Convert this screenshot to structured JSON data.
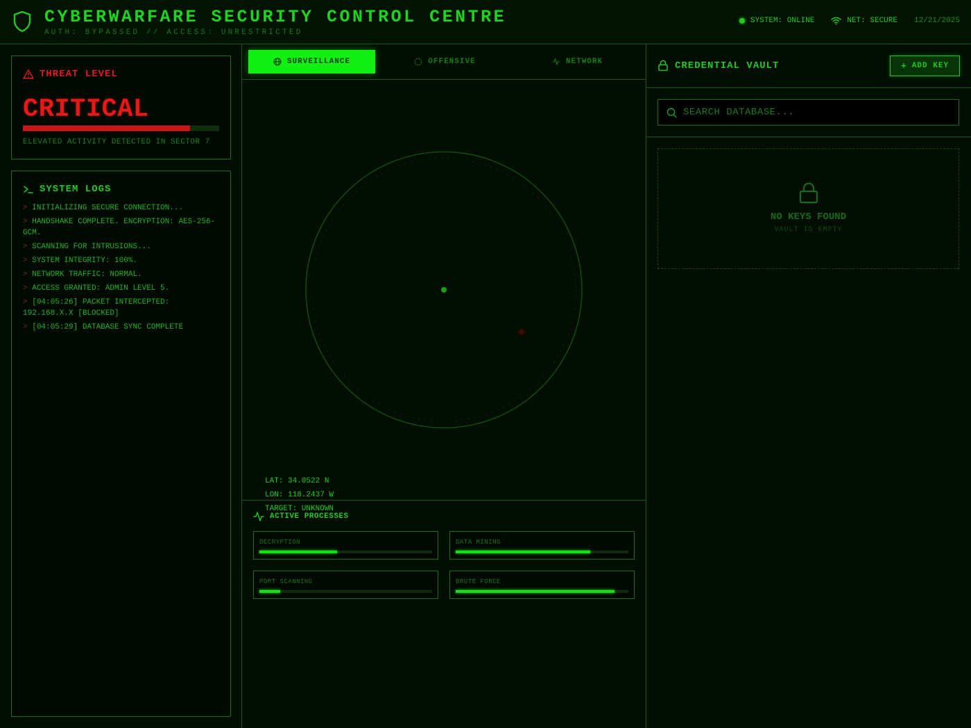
{
  "header": {
    "title": "CYBERWARFARE SECURITY CONTROL CENTRE",
    "subtitle": "AUTH: BYPASSED // ACCESS: UNRESTRICTED",
    "logo_icon": "shield-icon",
    "system_status": "SYSTEM: ONLINE",
    "net_status": "NET: SECURE",
    "date": "12/21/2025"
  },
  "threat": {
    "title": "THREAT LEVEL",
    "level": "CRITICAL",
    "level_fraction": 0.85,
    "caption": "ELEVATED ACTIVITY DETECTED IN SECTOR 7"
  },
  "logs": {
    "title": "SYSTEM LOGS",
    "prompt": ">",
    "entries": [
      "INITIALIZING SECURE CONNECTION...",
      "HANDSHAKE COMPLETE. ENCRYPTION: AES-256-GCM.",
      "SCANNING FOR INTRUSIONS...",
      "SYSTEM INTEGRITY: 100%.",
      "NETWORK TRAFFIC: NORMAL.",
      "ACCESS GRANTED: ADMIN LEVEL 5.",
      "[04:05:26] PACKET INTERCEPTED: 192.168.X.X [BLOCKED]",
      "[04:05:29] DATABASE SYNC COMPLETE"
    ]
  },
  "tabs": [
    {
      "label": "SURVEILLANCE",
      "icon": "globe-icon",
      "active": true
    },
    {
      "label": "OFFENSIVE",
      "icon": "crosshair-icon",
      "active": false
    },
    {
      "label": "NETWORK",
      "icon": "activity-icon",
      "active": false
    }
  ],
  "radar": {
    "lat": "LAT: 34.0522 N",
    "lon": "LON: 118.2437 W",
    "target": "TARGET: UNKNOWN"
  },
  "processes": {
    "title": "ACTIVE PROCESSES",
    "items": [
      {
        "label": "DECRYPTION",
        "progress": 0.45
      },
      {
        "label": "DATA MINING",
        "progress": 0.78
      },
      {
        "label": "PORT SCANNING",
        "progress": 0.12
      },
      {
        "label": "BRUTE FORCE",
        "progress": 0.92
      }
    ]
  },
  "vault": {
    "title": "CREDENTIAL VAULT",
    "add_label": "ADD KEY",
    "search_placeholder": "SEARCH DATABASE...",
    "empty_title": "NO KEYS FOUND",
    "empty_sub": "VAULT IS EMPTY"
  },
  "colors": {
    "accent": "#22c922",
    "danger": "#e61919",
    "active_tab": "#12f012",
    "background": "#010e01"
  }
}
